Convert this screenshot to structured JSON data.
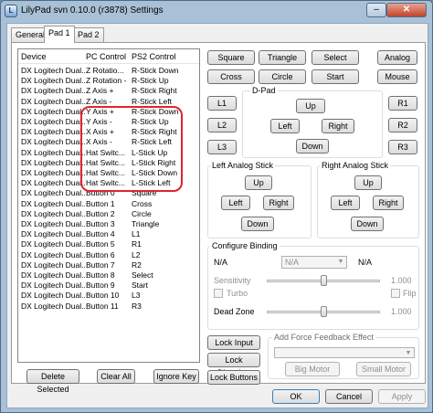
{
  "window": {
    "title": "LilyPad svn 0.10.0 (r3878) Settings",
    "app_icon_glyph": "L",
    "minimize_glyph": "–",
    "close_glyph": "✕"
  },
  "tabs": [
    {
      "label": "General"
    },
    {
      "label": "Pad 1"
    },
    {
      "label": "Pad 2"
    }
  ],
  "binding_list": {
    "headers": [
      "Device",
      "PC Control",
      "PS2 Control"
    ],
    "rows": [
      [
        "DX Logitech Dual...",
        "Z Rotatio...",
        "R-Stick Down"
      ],
      [
        "DX Logitech Dual...",
        "Z Rotation -",
        "R-Stick Up"
      ],
      [
        "DX Logitech Dual...",
        "Z Axis +",
        "R-Stick Right"
      ],
      [
        "DX Logitech Dual...",
        "Z Axis -",
        "R-Stick Left"
      ],
      [
        "DX Logitech Dual...",
        "Y Axis +",
        "R-Stick Down"
      ],
      [
        "DX Logitech Dual...",
        "Y Axis -",
        "R-Stick Up"
      ],
      [
        "DX Logitech Dual...",
        "X Axis +",
        "R-Stick Right"
      ],
      [
        "DX Logitech Dual...",
        "X Axis -",
        "R-Stick Left"
      ],
      [
        "DX Logitech Dual...",
        "Hat Switc...",
        "L-Stick Up"
      ],
      [
        "DX Logitech Dual...",
        "Hat Switc...",
        "L-Stick Right"
      ],
      [
        "DX Logitech Dual...",
        "Hat Switc...",
        "L-Stick Down"
      ],
      [
        "DX Logitech Dual...",
        "Hat Switc...",
        "L-Stick Left"
      ],
      [
        "DX Logitech Dual...",
        "Button 0",
        "Square"
      ],
      [
        "DX Logitech Dual...",
        "Button 1",
        "Cross"
      ],
      [
        "DX Logitech Dual...",
        "Button 2",
        "Circle"
      ],
      [
        "DX Logitech Dual...",
        "Button 3",
        "Triangle"
      ],
      [
        "DX Logitech Dual...",
        "Button 4",
        "L1"
      ],
      [
        "DX Logitech Dual...",
        "Button 5",
        "R1"
      ],
      [
        "DX Logitech Dual...",
        "Button 6",
        "L2"
      ],
      [
        "DX Logitech Dual...",
        "Button 7",
        "R2"
      ],
      [
        "DX Logitech Dual...",
        "Button 8",
        "Select"
      ],
      [
        "DX Logitech Dual...",
        "Button 9",
        "Start"
      ],
      [
        "DX Logitech Dual...",
        "Button 10",
        "L3"
      ],
      [
        "DX Logitech Dual...",
        "Button 11",
        "R3"
      ]
    ]
  },
  "list_buttons": {
    "delete_selected": "Delete Selected",
    "clear_all": "Clear All",
    "ignore_key": "Ignore Key"
  },
  "pad_buttons": {
    "square": "Square",
    "triangle": "Triangle",
    "select": "Select",
    "analog": "Analog",
    "cross": "Cross",
    "circle": "Circle",
    "start": "Start",
    "mouse": "Mouse",
    "l1": "L1",
    "r1": "R1",
    "l2": "L2",
    "r2": "R2",
    "l3": "L3",
    "r3": "R3"
  },
  "dpad": {
    "label": "D-Pad",
    "up": "Up",
    "left": "Left",
    "right": "Right",
    "down": "Down"
  },
  "left_stick": {
    "label": "Left Analog Stick",
    "up": "Up",
    "left": "Left",
    "right": "Right",
    "down": "Down"
  },
  "right_stick": {
    "label": "Right Analog Stick",
    "up": "Up",
    "left": "Left",
    "right": "Right",
    "down": "Down"
  },
  "configure_binding": {
    "label": "Configure Binding",
    "na_left": "N/A",
    "combo_value": "N/A",
    "na_right": "N/A",
    "sensitivity_label": "Sensitivity",
    "sensitivity_value": "1.000",
    "turbo_label": "Turbo",
    "flip_label": "Flip",
    "dead_zone_label": "Dead Zone",
    "dead_zone_value": "1.000",
    "sensitivity_level": 0.5,
    "dead_zone_level": 0.5
  },
  "lock_buttons": {
    "lock_input": "Lock Input",
    "lock_direction": "Lock Direction",
    "lock_buttons": "Lock Buttons"
  },
  "force_feedback": {
    "label": "Add Force Feedback Effect",
    "big_motor": "Big Motor",
    "small_motor": "Small Motor"
  },
  "dialog_buttons": {
    "ok": "OK",
    "cancel": "Cancel",
    "apply": "Apply"
  },
  "colors": {
    "highlight_outline": "#e0242f",
    "title_bar": "#a9c1d6"
  }
}
